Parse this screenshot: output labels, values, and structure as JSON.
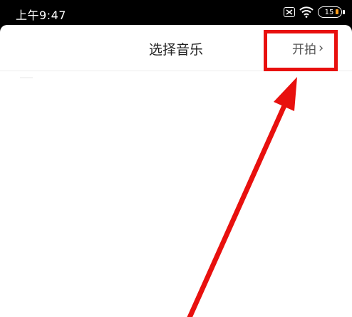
{
  "status_bar": {
    "time": "上午9:47",
    "battery_level": "15"
  },
  "header": {
    "title": "选择音乐",
    "start_label": "开拍"
  },
  "annotation": {
    "color": "#e8100e"
  }
}
